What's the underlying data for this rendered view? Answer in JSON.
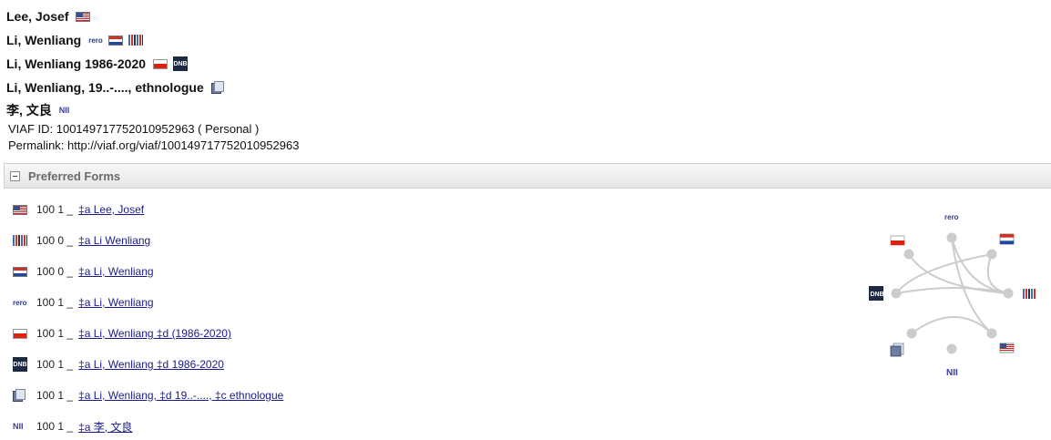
{
  "headings": [
    {
      "name": "Lee, Josef",
      "icons": [
        "us-flag-icon"
      ]
    },
    {
      "name": "Li, Wenliang",
      "icons": [
        "rero-icon",
        "netherlands-flag-icon",
        "wikidata-icon"
      ]
    },
    {
      "name": "Li, Wenliang 1986-2020",
      "icons": [
        "poland-flag-icon",
        "dnb-icon"
      ]
    },
    {
      "name": "Li, Wenliang, 19..-...., ethnologue",
      "icons": [
        "sudoc-icon"
      ]
    },
    {
      "name": "李, 文良",
      "icons": [
        "nii-icon"
      ]
    }
  ],
  "icon_text": {
    "rero": "rero",
    "dnb": "DNB",
    "nii": "NII"
  },
  "viaf_id": "VIAF ID: 100149717752010952963 ( Personal )",
  "permalink": "Permalink: http://viaf.org/viaf/100149717752010952963",
  "preferred_forms": {
    "title": "Preferred Forms",
    "rows": [
      {
        "icon": "us-flag-icon",
        "code": "100 1 _",
        "link": "‡a  Lee, Josef"
      },
      {
        "icon": "wikidata-icon",
        "code": "100 0 _",
        "link": "‡a  Li Wenliang"
      },
      {
        "icon": "netherlands-flag-icon",
        "code": "100 0 _",
        "link": "‡a  Li, Wenliang"
      },
      {
        "icon": "rero-icon",
        "code": "100 1 _",
        "link": "‡a  Li, Wenliang"
      },
      {
        "icon": "poland-flag-icon",
        "code": "100 1 _",
        "link": "‡a  Li, Wenliang ‡d  (1986-2020)"
      },
      {
        "icon": "dnb-icon",
        "code": "100 1 _",
        "link": "‡a  Li, Wenliang ‡d  1986-2020"
      },
      {
        "icon": "sudoc-icon",
        "code": "100 1 _",
        "link": "‡a  Li, Wenliang, ‡d  19..-...., ‡c  ethnologue"
      },
      {
        "icon": "nii-icon",
        "code": "100 1 _",
        "link": "‡a  李, 文良"
      }
    ]
  },
  "colors": {
    "link": "#1a1a8c",
    "graph_node": "#cccccc",
    "graph_edge": "#cccccc"
  }
}
